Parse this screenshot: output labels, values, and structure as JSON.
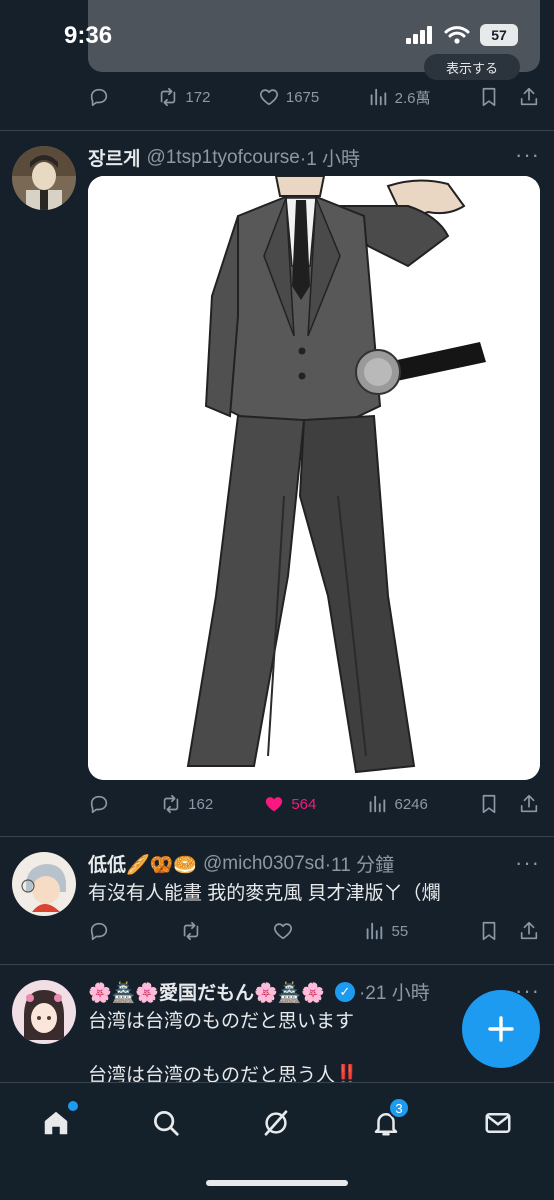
{
  "status_bar": {
    "time": "9:36",
    "battery": "57"
  },
  "prev_tweet": {
    "show_label": "表示する",
    "retweets": "172",
    "likes": "1675",
    "views": "2.6萬"
  },
  "tweets": [
    {
      "name": "장르게",
      "handle": "@1tsp1tyofcourse",
      "time": "·1 小時",
      "more": "···",
      "replies": "",
      "retweets": "162",
      "likes": "564",
      "views": "6246",
      "liked": true
    },
    {
      "name": "低低🥖🥨🥯",
      "handle": "@mich0307sd",
      "time": "·11 分鐘",
      "more": "···",
      "text": "有沒有人能畫 我的麥克風 貝才津版ㄚ（爛",
      "views": "55"
    },
    {
      "name": "🌸🏯🌸愛国だもん🌸🏯🌸",
      "time": "·21 小時",
      "more": "···",
      "line1": "台湾は台湾のものだと思います",
      "line2": "台湾は台湾のものだと思う人‼️"
    }
  ],
  "nav": {
    "notifications_count": "3"
  },
  "icons": [
    "reply-icon",
    "retweet-icon",
    "like-icon",
    "views-icon",
    "bookmark-icon",
    "share-icon",
    "home-icon",
    "search-icon",
    "grok-icon",
    "bell-icon",
    "mail-icon",
    "plus-icon"
  ],
  "colors": {
    "background": "#15202b",
    "accent": "#1d9bf0",
    "like": "#f91880",
    "muted": "#8b98a5",
    "divider": "#38444d"
  }
}
